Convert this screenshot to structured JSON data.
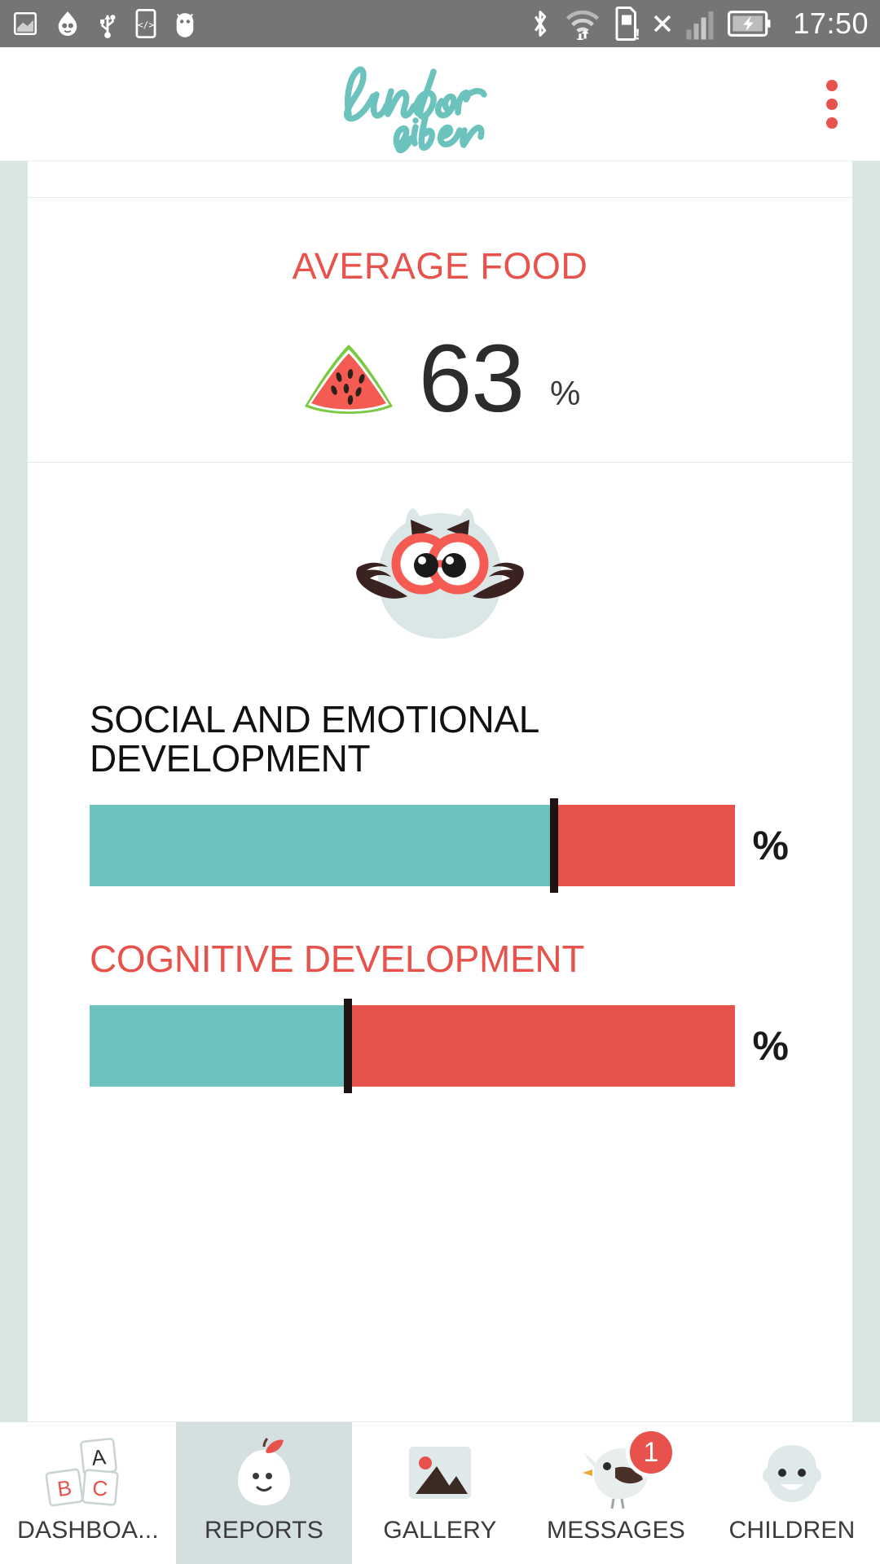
{
  "status_bar": {
    "time": "17:50",
    "icons": [
      "screenshot-icon",
      "app-icon",
      "usb-icon",
      "developer-icon",
      "android-icon"
    ],
    "right_icons": [
      "bluetooth-icon",
      "wifi-icon",
      "sd-card-icon",
      "no-sim-icon",
      "signal-icon",
      "battery-charging-icon"
    ],
    "background": "#757575"
  },
  "header": {
    "logo_text_line1": "kinder",
    "logo_text_line2": "vibe",
    "logo_color": "#6cc3bd",
    "overflow_menu": "more-options"
  },
  "food_card": {
    "title": "AVERAGE FOOD",
    "title_color": "#e8524c",
    "icon": "watermelon-icon",
    "value": "63",
    "unit": "%"
  },
  "development_card": {
    "mascot": "owl-icon",
    "metrics": [
      {
        "label": "SOCIAL AND EMOTIONAL DEVELOPMENT",
        "label_color": "#111111",
        "fill_percent": 72,
        "marker_percent": 72,
        "unit": "%",
        "fill_color": "#6cc3bd",
        "track_color": "#e8524c"
      },
      {
        "label": "COGNITIVE DEVELOPMENT",
        "label_color": "#e8524c",
        "fill_percent": 40,
        "marker_percent": 40,
        "unit": "%",
        "fill_color": "#6cc3bd",
        "track_color": "#e8524c"
      }
    ]
  },
  "bottom_nav": {
    "tabs": [
      {
        "label": "DASHBOA...",
        "icon": "abc-blocks-icon",
        "active": false,
        "badge": null
      },
      {
        "label": "REPORTS",
        "icon": "apple-icon",
        "active": true,
        "badge": null
      },
      {
        "label": "GALLERY",
        "icon": "photo-icon",
        "active": false,
        "badge": null
      },
      {
        "label": "MESSAGES",
        "icon": "bird-icon",
        "active": false,
        "badge": "1"
      },
      {
        "label": "CHILDREN",
        "icon": "child-face-icon",
        "active": false,
        "badge": null
      }
    ]
  },
  "theme": {
    "teal": "#6cc3bd",
    "coral": "#e8524c",
    "page_bg": "#d8e6e4",
    "card_bg": "#ffffff"
  }
}
